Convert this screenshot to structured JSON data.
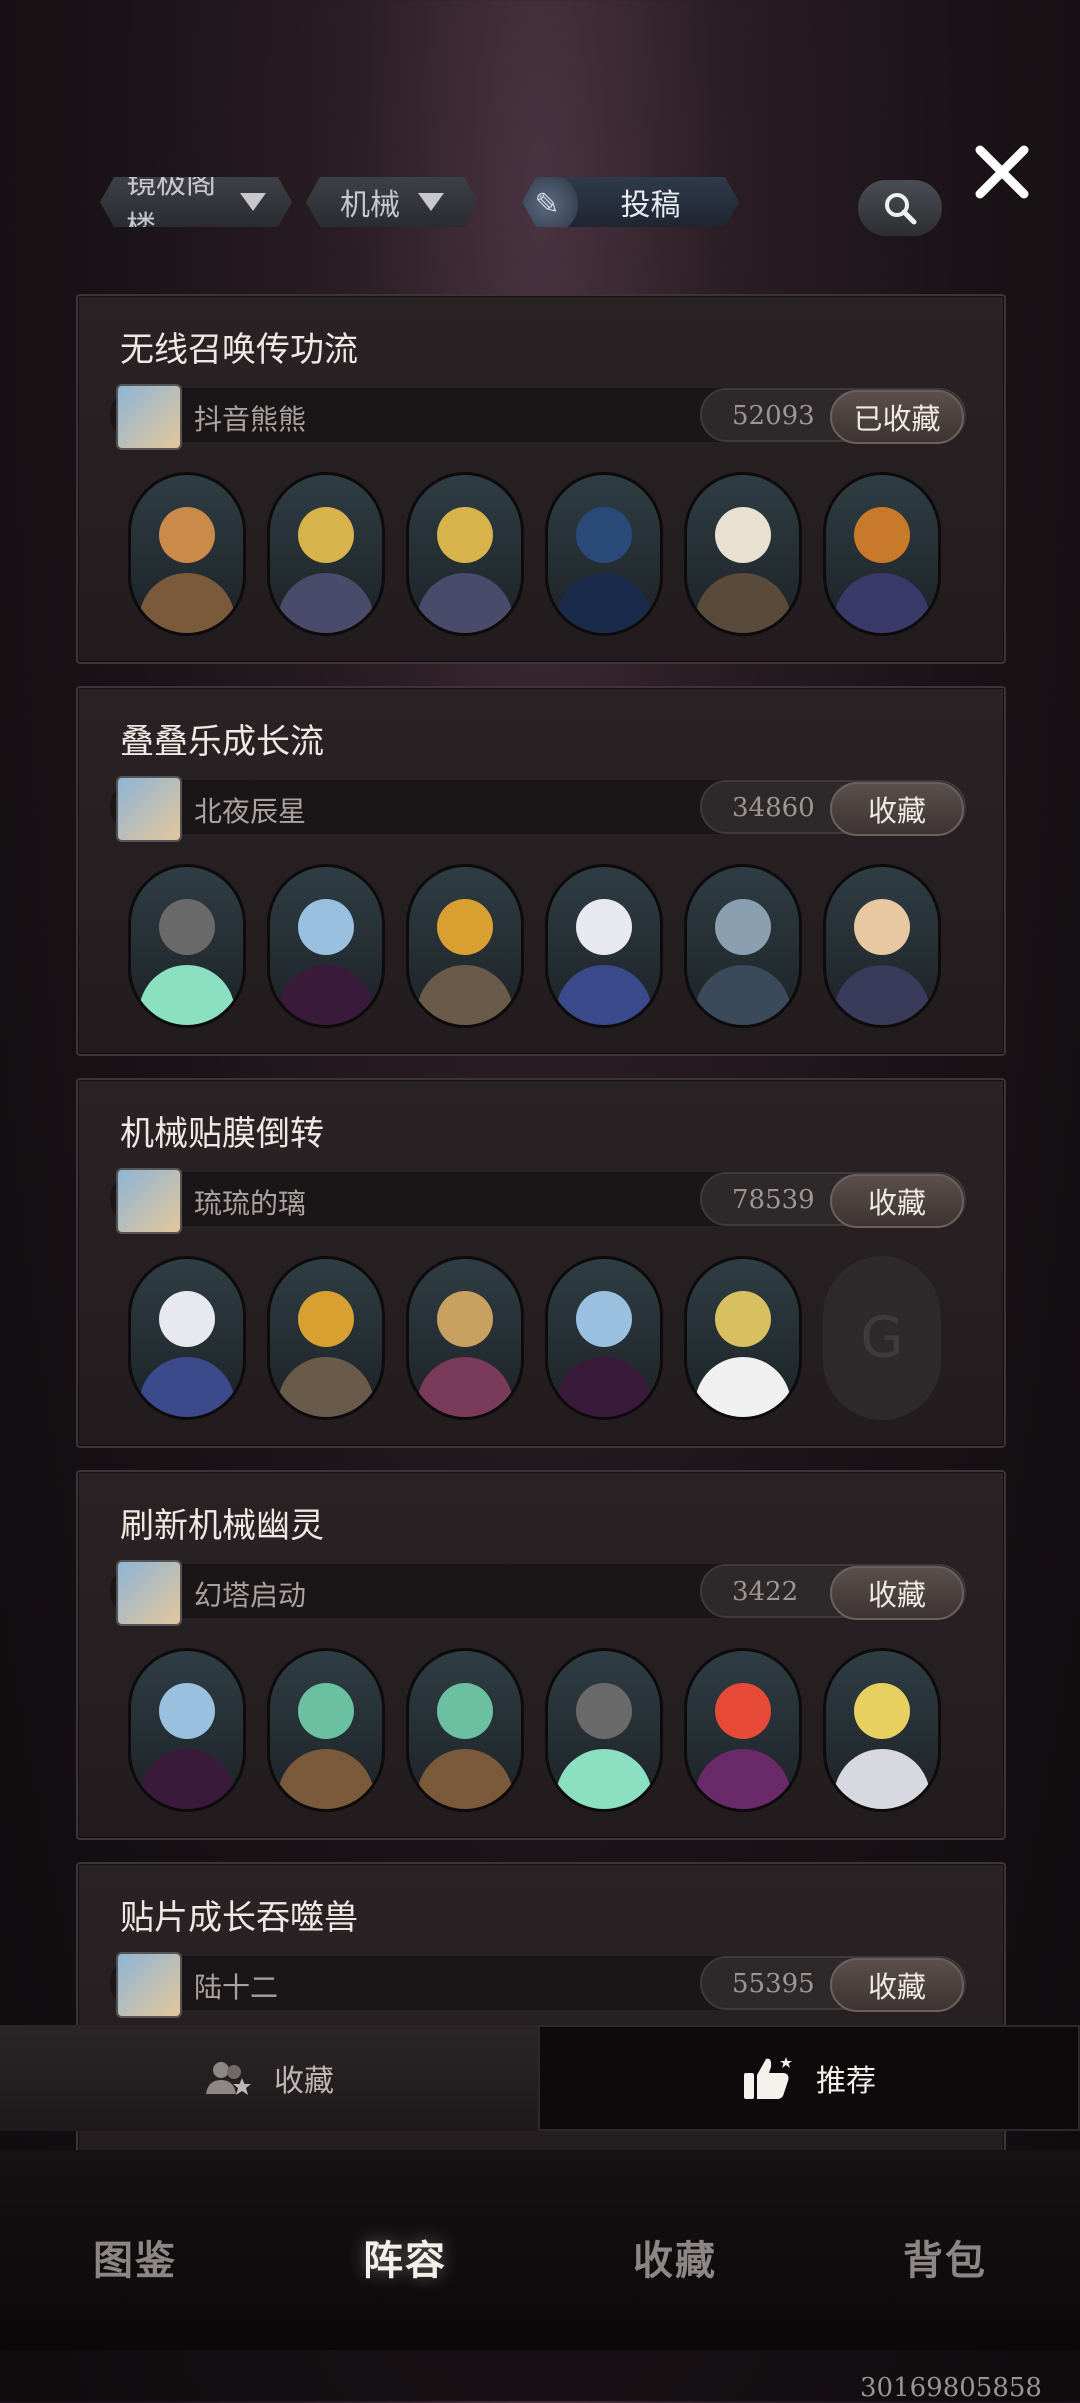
{
  "filters": {
    "tower": "镜极阁楼",
    "type": "机械",
    "submit": "投稿"
  },
  "icons": {
    "search": "search-icon",
    "close": "close-icon",
    "favorites_tab": "users-star-icon",
    "recommend_tab": "thumbs-up-icon"
  },
  "cards": [
    {
      "title": "无线召唤传功流",
      "author": "抖音熊熊",
      "count": "52093",
      "fav": "已收藏",
      "units": [
        [
          "#c98a4a",
          "#7a5a3a"
        ],
        [
          "#d8b24a",
          "#4a4a6a"
        ],
        [
          "#d8b24a",
          "#4a4a6a"
        ],
        [
          "#2a4a7a",
          "#1a2a4a"
        ],
        [
          "#e8e0d0",
          "#5a4a3a"
        ],
        [
          "#c87a2a",
          "#3a3a6a"
        ]
      ]
    },
    {
      "title": "叠叠乐成长流",
      "author": "北夜辰星",
      "count": "34860",
      "fav": "收藏",
      "units": [
        [
          "#6a6a6a",
          "#8ae0c0"
        ],
        [
          "#9ac0e0",
          "#3a1a3a"
        ],
        [
          "#d8a030",
          "#6a5a4a"
        ],
        [
          "#e8e8f0",
          "#3a4a8a"
        ],
        [
          "#8aa0b0",
          "#3a4a5a"
        ],
        [
          "#e8c8a0",
          "#3a3a5a"
        ]
      ]
    },
    {
      "title": "机械贴膜倒转",
      "author": "琉琉的璃",
      "count": "78539",
      "fav": "收藏",
      "units": [
        [
          "#e8e8f0",
          "#3a4a8a"
        ],
        [
          "#d8a030",
          "#6a5a4a"
        ],
        [
          "#c8a060",
          "#7a3a5a"
        ],
        [
          "#9ac0e0",
          "#3a1a3a"
        ],
        [
          "#d8c060",
          "#f0f0f0"
        ],
        null
      ]
    },
    {
      "title": "刷新机械幽灵",
      "author": "幻塔启动",
      "count": "3422",
      "fav": "收藏",
      "units": [
        [
          "#9ac0e0",
          "#3a1a3a"
        ],
        [
          "#6ac0a0",
          "#7a5a3a"
        ],
        [
          "#6ac0a0",
          "#7a5a3a"
        ],
        [
          "#6a6a6a",
          "#8ae0c0"
        ],
        [
          "#e84a3a",
          "#6a2a6a"
        ],
        [
          "#e8d060",
          "#d8d8e0"
        ]
      ]
    },
    {
      "title": "贴片成长吞噬兽",
      "author": "陆十二",
      "count": "55395",
      "fav": "收藏",
      "units": []
    }
  ],
  "bottom_tabs": {
    "favorites": "收藏",
    "recommend": "推荐"
  },
  "nav": {
    "catalog": "图鉴",
    "lineup": "阵容",
    "collection": "收藏",
    "backpack": "背包"
  },
  "user_id": "30169805858"
}
